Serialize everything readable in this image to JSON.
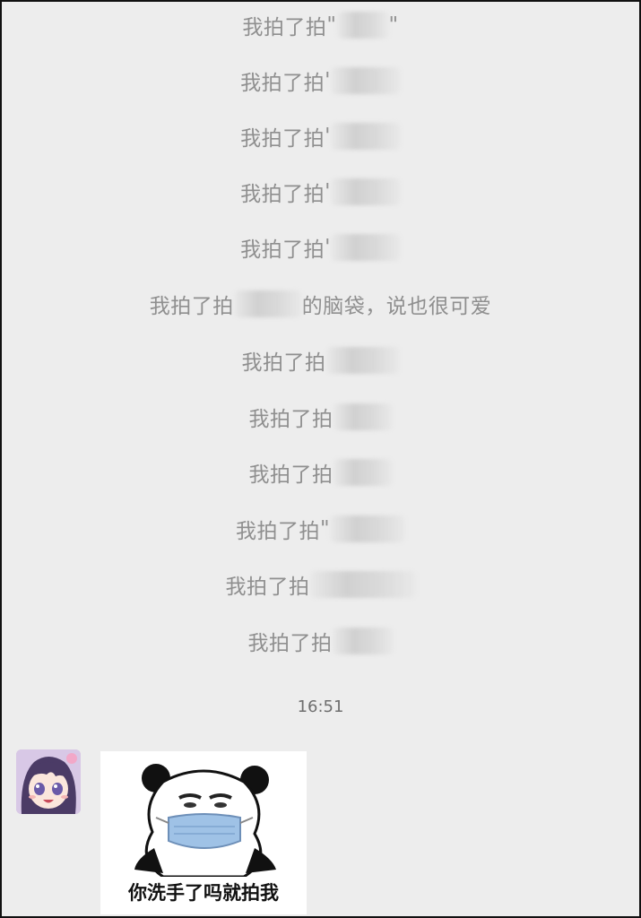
{
  "messages": [
    {
      "prefix": "我拍了拍",
      "open_quote": "\"",
      "suffix": "\"",
      "blur_w": 58
    },
    {
      "prefix": "我拍了拍",
      "open_quote": "'",
      "suffix": "",
      "blur_w": 78
    },
    {
      "prefix": "我拍了拍",
      "open_quote": "'",
      "suffix": "",
      "blur_w": 78
    },
    {
      "prefix": "我拍了拍",
      "open_quote": "'",
      "suffix": "",
      "blur_w": 78
    },
    {
      "prefix": "我拍了拍",
      "open_quote": "'",
      "suffix": "",
      "blur_w": 78
    },
    {
      "prefix": "我拍了拍",
      "open_quote": "",
      "suffix": "的脑袋，说也很可爱",
      "blur_w": 76
    },
    {
      "prefix": "我拍了拍",
      "open_quote": "",
      "suffix": "",
      "blur_w": 82
    },
    {
      "prefix": "我拍了拍",
      "open_quote": "",
      "suffix": "",
      "blur_w": 66
    },
    {
      "prefix": "我拍了拍",
      "open_quote": "",
      "suffix": "",
      "blur_w": 66
    },
    {
      "prefix": "我拍了拍",
      "open_quote": "\"",
      "suffix": "",
      "blur_w": 84
    },
    {
      "prefix": "我拍了拍",
      "open_quote": "",
      "suffix": "",
      "blur_w": 118
    },
    {
      "prefix": "我拍了拍",
      "open_quote": "",
      "suffix": "",
      "blur_w": 68
    }
  ],
  "timestamp": "16:51",
  "sticker": {
    "caption": "你洗手了吗就拍我"
  },
  "colors": {
    "background": "#ededed",
    "system_text": "#8f8f8f",
    "mask_blue": "#9fc2e6"
  }
}
